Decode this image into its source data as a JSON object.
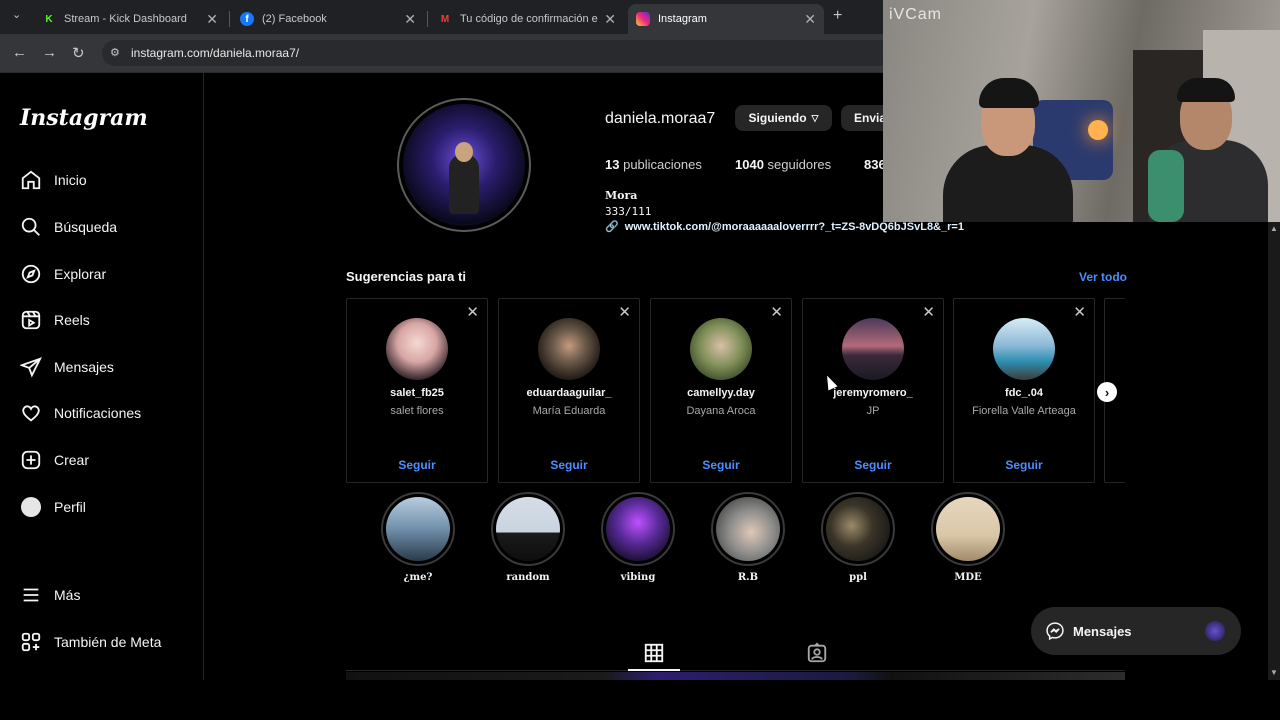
{
  "browser": {
    "tabs": [
      {
        "label": "Stream - Kick Dashboard",
        "icon": "kick-icon"
      },
      {
        "label": "(2) Facebook",
        "icon": "facebook-icon"
      },
      {
        "label": "Tu código de confirmación es F",
        "icon": "gmail-icon"
      },
      {
        "label": "Instagram",
        "icon": "instagram-icon"
      }
    ],
    "url": "instagram.com/daniela.moraa7/"
  },
  "sidebar": {
    "logo": "Instagram",
    "items": [
      {
        "label": "Inicio",
        "icon": "home-icon"
      },
      {
        "label": "Búsqueda",
        "icon": "search-icon"
      },
      {
        "label": "Explorar",
        "icon": "compass-icon"
      },
      {
        "label": "Reels",
        "icon": "reels-icon"
      },
      {
        "label": "Mensajes",
        "icon": "send-icon"
      },
      {
        "label": "Notificaciones",
        "icon": "heart-icon"
      },
      {
        "label": "Crear",
        "icon": "plus-square-icon"
      },
      {
        "label": "Perfil",
        "icon": "avatar-icon"
      }
    ],
    "more": {
      "label": "Más",
      "icon": "menu-icon"
    },
    "meta": {
      "label": "También de Meta",
      "icon": "grid-apps-icon"
    }
  },
  "profile": {
    "username": "daniela.moraa7",
    "following_button": "Siguiendo",
    "message_button": "Envia",
    "stats": {
      "posts_count": "13",
      "posts_label": "publicaciones",
      "followers_count": "1040",
      "followers_label": "seguidores",
      "following_count": "836"
    },
    "bio": {
      "name": "Mora",
      "line": "333/111",
      "link": "www.tiktok.com/@moraaaaaaloverrrr?_t=ZS-8vDQ6bJSvL8&_r=1"
    }
  },
  "suggestions": {
    "title": "Sugerencias para ti",
    "see_all": "Ver todo",
    "follow_label": "Seguir",
    "cards": [
      {
        "username": "salet_fb25",
        "name": "salet flores",
        "color": "#e8d2d8"
      },
      {
        "username": "eduardaaguilar_",
        "name": "María Eduarda",
        "color": "#6b5a4a"
      },
      {
        "username": "camellyy.day",
        "name": "Dayana Aroca",
        "color": "#7f8f58"
      },
      {
        "username": "jeremyromero_",
        "name": "JP",
        "color": "#5a3a55"
      },
      {
        "username": "fdc_.04",
        "name": "Fiorella Valle Arteaga",
        "color": "#8bb8d6"
      }
    ]
  },
  "highlights": [
    {
      "label": "¿me?",
      "color": "#9cb3c7"
    },
    {
      "label": "random",
      "color": "#c9d4e0"
    },
    {
      "label": "vibing",
      "color": "#5a2c9a"
    },
    {
      "label": "R.B",
      "color": "#8c8c8a"
    },
    {
      "label": "ppl",
      "color": "#3b3528"
    },
    {
      "label": "MDE",
      "color": "#d9c7a8"
    }
  ],
  "profile_tabs": [
    {
      "icon": "grid-icon",
      "active": true
    },
    {
      "icon": "tagged-icon",
      "active": false
    }
  ],
  "messages_pill": {
    "label": "Mensajes",
    "icon": "messenger-icon"
  },
  "webcam": {
    "watermark": "iVCam"
  }
}
